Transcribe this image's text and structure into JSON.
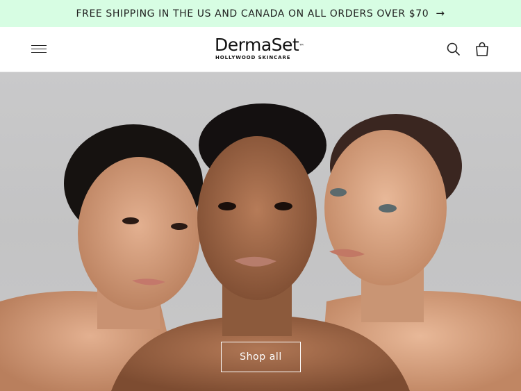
{
  "announcement": {
    "text": "FREE SHIPPING IN THE US AND CANADA ON ALL ORDERS OVER $70",
    "arrow_icon": "arrow-right-icon",
    "background": "#d7fde3"
  },
  "header": {
    "menu_icon": "hamburger-menu-icon",
    "logo": {
      "name": "DermaSet",
      "trademark": "™",
      "tagline": "HOLLYWOOD SKINCARE"
    },
    "search_icon": "search-icon",
    "cart_icon": "cart-icon"
  },
  "hero": {
    "image": "three-models-portrait",
    "cta_label": "Shop all"
  }
}
